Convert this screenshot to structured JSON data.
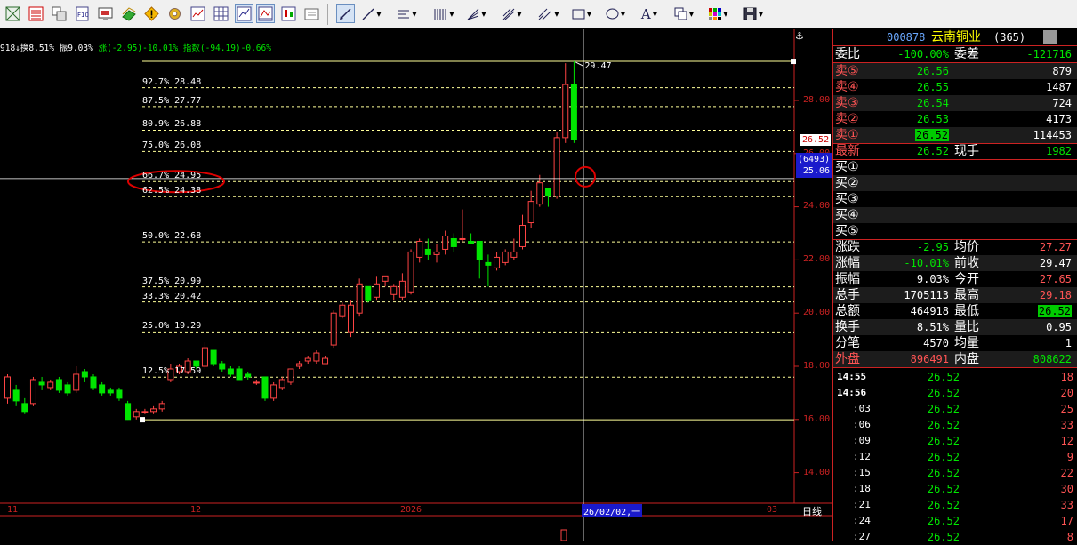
{
  "toolbar": {
    "icons": [
      "chart-grid-icon",
      "table-list-icon",
      "windows-icon",
      "f10-icon",
      "screen-icon",
      "stock-icon",
      "warning-icon",
      "gear-icon",
      "minute-chart-icon",
      "table-icon",
      "kline-chart-icon",
      "period-chart-icon",
      "popout-icon",
      "draw-select-icon",
      "line-tool-icon",
      "parallel-tool-icon",
      "fibonacci-tool-icon",
      "fan-tool-icon",
      "gann-tool-icon",
      "channel-tool-icon",
      "rectangle-tool-icon",
      "ellipse-tool-icon",
      "text-tool-icon",
      "copy-tool-icon",
      "color-tool-icon",
      "save-icon"
    ],
    "text_tool_label": "A"
  },
  "chart": {
    "info_line": {
      "prefix": "918",
      "vol_label": "↓换8.51%",
      "amp_label": "振9.03%",
      "chg_label": "涨(-2.95)-10.01%",
      "idx_label": "指数(-94.19)-0.66%"
    },
    "fib_levels": [
      {
        "label": "92.7% 28.48",
        "price": 28.48
      },
      {
        "label": "87.5% 27.77",
        "price": 27.77
      },
      {
        "label": "80.9% 26.88",
        "price": 26.88
      },
      {
        "label": "75.0% 26.08",
        "price": 26.08
      },
      {
        "label": "66.7% 24.95",
        "price": 24.95
      },
      {
        "label": "62.5% 24.38",
        "price": 24.38
      },
      {
        "label": "50.0% 22.68",
        "price": 22.68
      },
      {
        "label": "37.5% 20.99",
        "price": 20.99
      },
      {
        "label": "33.3% 20.42",
        "price": 20.42
      },
      {
        "label": "25.0% 19.29",
        "price": 19.29
      },
      {
        "label": "12.5% 17.59",
        "price": 17.59
      }
    ],
    "fib_high": 29.47,
    "fib_low": 15.99,
    "high_label": "29.47",
    "y_ticks": [
      "28.00",
      "26.00",
      "24.00",
      "22.00",
      "20.00",
      "18.00",
      "16.00",
      "14.00"
    ],
    "x_ticks": [
      "11",
      "12",
      "2026",
      "03"
    ],
    "last_price_tag": "26.52",
    "cursor_volume_tag": "(6493)",
    "cursor_price_tag": "25.06",
    "cursor_date": "26/02/02,一",
    "period_label": "日线",
    "colors": {
      "up": "#ff4444",
      "down": "#00e600",
      "fib_line": "#ffff99",
      "annotation": "#dd0000"
    }
  },
  "chart_data": {
    "type": "candlestick",
    "ylim": [
      13.5,
      29.8
    ],
    "candles": [
      [
        16.8,
        17.6,
        16.6,
        17.7
      ],
      [
        17.1,
        16.7,
        16.5,
        17.3
      ],
      [
        16.6,
        16.3,
        16.2,
        16.8
      ],
      [
        16.6,
        17.5,
        16.5,
        17.6
      ],
      [
        17.4,
        17.3,
        17.1,
        17.6
      ],
      [
        17.2,
        17.4,
        17.1,
        17.5
      ],
      [
        17.5,
        17.1,
        17.0,
        17.6
      ],
      [
        17.3,
        17.0,
        16.9,
        17.4
      ],
      [
        17.1,
        17.7,
        17.0,
        18.0
      ],
      [
        17.8,
        17.6,
        17.4,
        17.9
      ],
      [
        17.6,
        17.2,
        17.1,
        17.7
      ],
      [
        17.3,
        17.0,
        16.9,
        17.4
      ],
      [
        17.1,
        17.0,
        16.9,
        17.2
      ],
      [
        17.1,
        16.8,
        16.7,
        17.2
      ],
      [
        16.6,
        16.0,
        15.99,
        16.7
      ],
      [
        16.1,
        16.3,
        16.0,
        16.4
      ],
      [
        16.3,
        16.3,
        16.2,
        16.4
      ],
      [
        16.3,
        16.4,
        16.2,
        16.5
      ],
      [
        16.4,
        16.6,
        16.3,
        16.7
      ],
      [
        17.5,
        17.9,
        17.4,
        18.1
      ],
      [
        17.8,
        18.0,
        17.7,
        18.1
      ],
      [
        17.8,
        18.2,
        17.7,
        18.3
      ],
      [
        18.2,
        18.0,
        17.9,
        18.2
      ],
      [
        18.0,
        18.7,
        17.9,
        18.9
      ],
      [
        18.6,
        18.1,
        18.0,
        18.6
      ],
      [
        18.1,
        17.9,
        17.8,
        18.2
      ],
      [
        17.9,
        17.7,
        17.6,
        18.0
      ],
      [
        17.9,
        17.5,
        17.5,
        18.0
      ],
      [
        17.7,
        17.6,
        17.5,
        17.8
      ],
      [
        17.4,
        17.4,
        17.3,
        17.5
      ],
      [
        17.6,
        16.8,
        16.7,
        17.6
      ],
      [
        16.8,
        17.3,
        16.7,
        17.4
      ],
      [
        17.2,
        17.5,
        17.1,
        17.6
      ],
      [
        17.4,
        17.9,
        17.3,
        17.9
      ],
      [
        18.0,
        18.1,
        17.9,
        18.2
      ],
      [
        18.2,
        18.3,
        18.1,
        18.4
      ],
      [
        18.2,
        18.5,
        18.1,
        18.6
      ],
      [
        18.1,
        18.3,
        18.1,
        18.4
      ],
      [
        18.8,
        20.0,
        18.7,
        20.1
      ],
      [
        19.9,
        20.3,
        19.8,
        20.4
      ],
      [
        19.3,
        20.3,
        19.1,
        20.5
      ],
      [
        20.0,
        21.1,
        19.9,
        21.3
      ],
      [
        21.0,
        20.5,
        20.4,
        21.0
      ],
      [
        20.6,
        21.1,
        20.5,
        21.4
      ],
      [
        21.2,
        21.4,
        21.0,
        21.4
      ],
      [
        20.7,
        21.0,
        20.5,
        21.1
      ],
      [
        20.6,
        21.2,
        20.5,
        21.5
      ],
      [
        20.8,
        22.3,
        20.7,
        22.4
      ],
      [
        22.1,
        22.7,
        21.9,
        22.8
      ],
      [
        22.4,
        22.2,
        22.0,
        22.8
      ],
      [
        22.2,
        22.3,
        21.9,
        22.6
      ],
      [
        22.4,
        22.9,
        22.2,
        23.1
      ],
      [
        22.8,
        22.5,
        22.3,
        23.0
      ],
      [
        22.8,
        22.8,
        22.7,
        23.9
      ],
      [
        22.7,
        22.6,
        22.6,
        23.0
      ],
      [
        22.7,
        22.0,
        21.3,
        22.7
      ],
      [
        21.9,
        21.8,
        21.0,
        22.2
      ],
      [
        21.7,
        22.1,
        21.6,
        22.3
      ],
      [
        21.9,
        22.3,
        21.8,
        22.4
      ],
      [
        22.1,
        22.3,
        22.0,
        22.8
      ],
      [
        22.5,
        23.3,
        22.4,
        23.7
      ],
      [
        23.4,
        24.2,
        23.2,
        24.6
      ],
      [
        24.1,
        24.9,
        24.0,
        25.2
      ],
      [
        24.7,
        24.4,
        24.0,
        24.7
      ],
      [
        24.4,
        26.6,
        24.3,
        26.8
      ],
      [
        26.6,
        28.6,
        26.4,
        29.4
      ],
      [
        28.6,
        26.52,
        26.4,
        29.47
      ]
    ]
  },
  "quote": {
    "code": "000878",
    "name": "云南铜业",
    "count": "(365)",
    "weibi": {
      "l1": "委比",
      "v1": "-100.00%",
      "l2": "委差",
      "v2": "-121716"
    },
    "sell": [
      {
        "label": "卖⑤",
        "price": "26.56",
        "vol": "879"
      },
      {
        "label": "卖④",
        "price": "26.55",
        "vol": "1487"
      },
      {
        "label": "卖③",
        "price": "26.54",
        "vol": "724"
      },
      {
        "label": "卖②",
        "price": "26.53",
        "vol": "4173"
      },
      {
        "label": "卖①",
        "price": "26.52",
        "vol": "114453"
      }
    ],
    "latest": {
      "l1": "最新",
      "v1": "26.52",
      "l2": "现手",
      "v2": "1982"
    },
    "buy": [
      {
        "label": "买①"
      },
      {
        "label": "买②"
      },
      {
        "label": "买③"
      },
      {
        "label": "买④"
      },
      {
        "label": "买⑤"
      }
    ],
    "stats": [
      {
        "l1": "涨跌",
        "v1": "-2.95",
        "l2": "均价",
        "v2": "27.27"
      },
      {
        "l1": "涨幅",
        "v1": "-10.01%",
        "l2": "前收",
        "v2": "29.47"
      },
      {
        "l1": "振幅",
        "v1": "9.03%",
        "l2": "今开",
        "v2": "27.65"
      },
      {
        "l1": "总手",
        "v1": "1705113",
        "l2": "最高",
        "v2": "29.18"
      },
      {
        "l1": "总额",
        "v1": "464918",
        "l2": "最低",
        "v2": "26.52"
      },
      {
        "l1": "换手",
        "v1": "8.51%",
        "l2": "量比",
        "v2": "0.95"
      },
      {
        "l1": "分笔",
        "v1": "4570",
        "l2": "均量",
        "v2": "1"
      }
    ],
    "outer": {
      "l1": "外盘",
      "v1": "896491",
      "l2": "内盘",
      "v2": "808622"
    },
    "ticks": [
      {
        "t": "14:55",
        "p": "26.52",
        "v": "18"
      },
      {
        "t": "14:56",
        "p": "26.52",
        "v": "20"
      },
      {
        "t": ":03",
        "p": "26.52",
        "v": "25"
      },
      {
        "t": ":06",
        "p": "26.52",
        "v": "33"
      },
      {
        "t": ":09",
        "p": "26.52",
        "v": "12"
      },
      {
        "t": ":12",
        "p": "26.52",
        "v": "9"
      },
      {
        "t": ":15",
        "p": "26.52",
        "v": "22"
      },
      {
        "t": ":18",
        "p": "26.52",
        "v": "30"
      },
      {
        "t": ":21",
        "p": "26.52",
        "v": "33"
      },
      {
        "t": ":24",
        "p": "26.52",
        "v": "17"
      },
      {
        "t": ":27",
        "p": "26.52",
        "v": "8"
      }
    ]
  }
}
